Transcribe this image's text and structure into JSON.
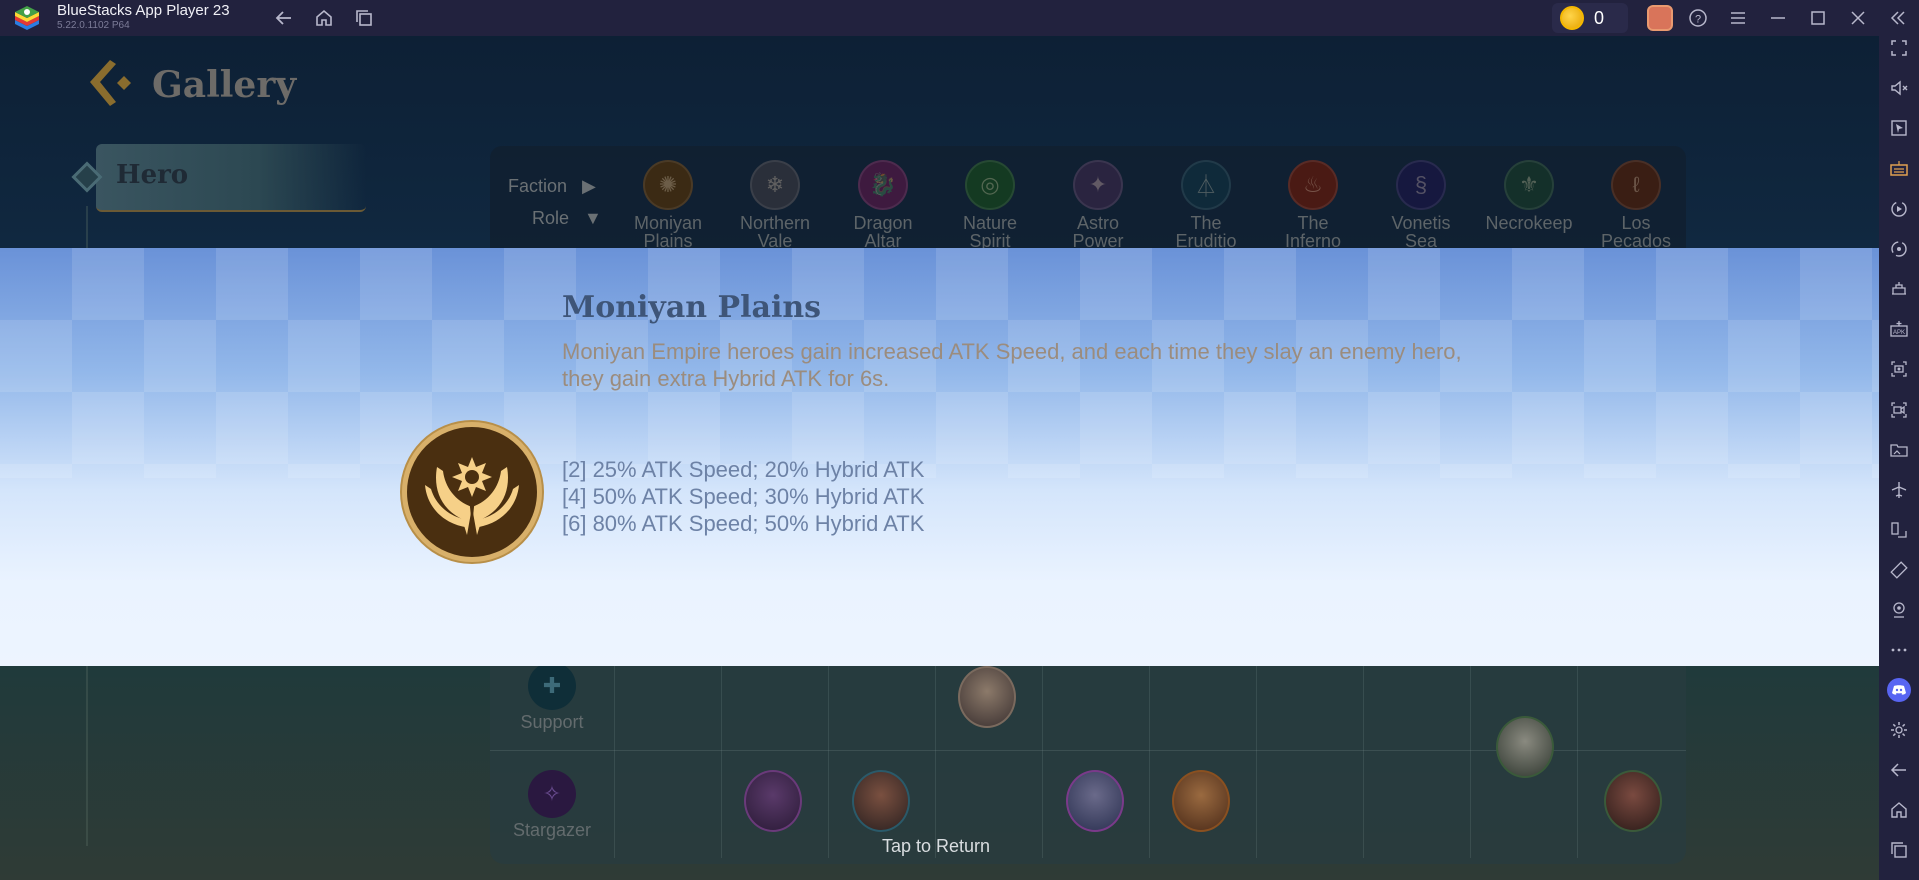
{
  "window": {
    "title": "BlueStacks App Player 23",
    "version": "5.22.0.1102  P64",
    "coin_count": "0",
    "icons": [
      "back-icon",
      "home-icon",
      "recent-apps-icon",
      "coin-icon",
      "profile-avatar",
      "help-icon",
      "menu-icon",
      "minimize-icon",
      "maximize-icon",
      "close-icon",
      "collapse-sidebar-icon"
    ]
  },
  "sidebar": {
    "items": [
      {
        "name": "fullscreen-icon",
        "label": "Fullscreen"
      },
      {
        "name": "volume-mute-icon",
        "label": "Volume"
      },
      {
        "name": "pointer-icon",
        "label": "Pointer"
      },
      {
        "name": "keyboard-icon",
        "label": "Keyboard controls"
      },
      {
        "name": "record-replay-icon",
        "label": "Macro recorder"
      },
      {
        "name": "rotate-sync-icon",
        "label": "Sync"
      },
      {
        "name": "instance-manager-icon",
        "label": "Multi-instance"
      },
      {
        "name": "apk-install-icon",
        "label": "Install APK"
      },
      {
        "name": "screenshot-icon",
        "label": "Screenshot"
      },
      {
        "name": "screen-record-icon",
        "label": "Record screen"
      },
      {
        "name": "media-folder-icon",
        "label": "Media folder"
      },
      {
        "name": "airplane-mode-icon",
        "label": "Airplane mode"
      },
      {
        "name": "resize-icon",
        "label": "Resize"
      },
      {
        "name": "rotate-screen-icon",
        "label": "Rotate"
      },
      {
        "name": "location-icon",
        "label": "Location"
      },
      {
        "name": "more-icon",
        "label": "More"
      },
      {
        "name": "discord-icon",
        "label": "Discord"
      },
      {
        "name": "settings-icon",
        "label": "Settings"
      },
      {
        "name": "android-back-icon",
        "label": "Back"
      },
      {
        "name": "android-home-icon",
        "label": "Home"
      },
      {
        "name": "android-recents-icon",
        "label": "Recent apps"
      }
    ]
  },
  "game": {
    "header": "Gallery",
    "tab": "Hero",
    "filters": {
      "faction": "Faction",
      "role": "Role"
    },
    "factions": [
      {
        "name": "Moniyan\nPlains",
        "color": "#3b2a14",
        "glyph": "✺"
      },
      {
        "name": "Northern\nVale",
        "color": "#2a2f3a",
        "glyph": "❄"
      },
      {
        "name": "Dragon\nAltar",
        "color": "#3e1a3f",
        "glyph": "🐉"
      },
      {
        "name": "Nature\nSpirit",
        "color": "#143a22",
        "glyph": "◎"
      },
      {
        "name": "Astro\nPower",
        "color": "#2a2440",
        "glyph": "✦"
      },
      {
        "name": "The\nEruditio",
        "color": "#0f2a3a",
        "glyph": "⏃"
      },
      {
        "name": "The\nInferno",
        "color": "#4a1a14",
        "glyph": "♨"
      },
      {
        "name": "Vonetis\nSea",
        "color": "#16183f",
        "glyph": "§"
      },
      {
        "name": "Necrokeep",
        "color": "#14302a",
        "glyph": "⚜"
      },
      {
        "name": "Los\nPecados",
        "color": "#3a1e14",
        "glyph": "ℓ"
      }
    ],
    "roles": [
      {
        "name": "Support",
        "color": "#0f2e38",
        "glyph": "✚"
      },
      {
        "name": "Stargazer",
        "color": "#2a1840",
        "glyph": "✧"
      }
    ],
    "tap_to_return": "Tap to Return"
  },
  "banner": {
    "title": "Moniyan Plains",
    "description": "Moniyan Empire heroes gain increased ATK Speed, and each time they slay an enemy hero, they gain extra Hybrid ATK for 6s.",
    "tiers": [
      "[2] 25% ATK Speed; 20% Hybrid ATK",
      "[4] 50% ATK Speed; 30% Hybrid ATK",
      "[6] 80% ATK Speed; 50% Hybrid ATK"
    ]
  }
}
